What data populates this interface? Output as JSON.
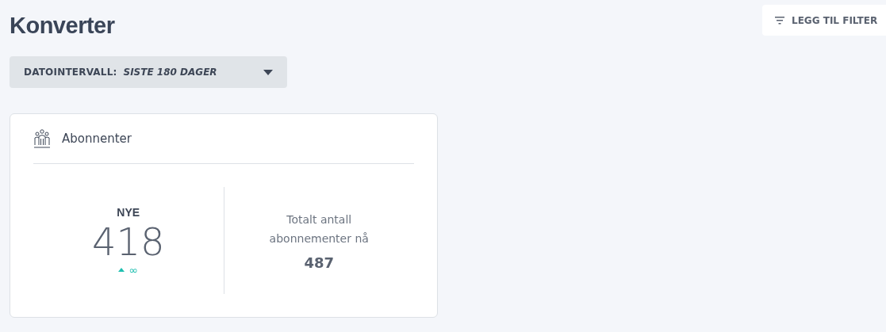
{
  "page": {
    "title": "Konverter"
  },
  "filter_button": {
    "label": "LEGG TIL FILTER"
  },
  "date_range": {
    "label": "DATOINTERVALL:",
    "value": "SISTE 180 DAGER"
  },
  "card": {
    "title": "Abonnenter",
    "new": {
      "label": "NYE",
      "value": "418",
      "trend": {
        "up": true,
        "text": "∞"
      }
    },
    "total": {
      "label": "Totalt antall abonnementer nå",
      "value": "487"
    }
  }
}
